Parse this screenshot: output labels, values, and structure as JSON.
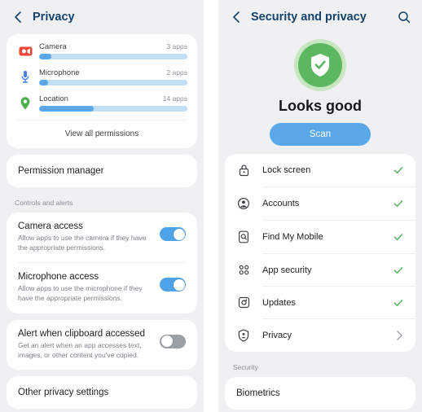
{
  "left": {
    "header": {
      "title": "Privacy",
      "back_icon": "chevron-left-icon"
    },
    "permissions": {
      "items": [
        {
          "icon": "camera-icon",
          "name": "Camera",
          "count": "3 apps",
          "fill_pct": 8
        },
        {
          "icon": "microphone-icon",
          "name": "Microphone",
          "count": "2 apps",
          "fill_pct": 6
        },
        {
          "icon": "location-pin-icon",
          "name": "Location",
          "count": "14 apps",
          "fill_pct": 37
        }
      ],
      "view_all_label": "View all permissions"
    },
    "permission_manager_label": "Permission manager",
    "controls_section_label": "Controls and alerts",
    "toggles": [
      {
        "icon": "toggle-icon",
        "title": "Camera access",
        "description": "Allow apps to use the camera if they have the appropriate permissions.",
        "state": "on"
      },
      {
        "icon": "toggle-icon",
        "title": "Microphone access",
        "description": "Allow apps to use the microphone if they have the appropriate permissions.",
        "state": "on"
      },
      {
        "icon": "toggle-icon",
        "title": "Alert when clipboard accessed",
        "description": "Get an alert when an app accesses text, images, or other content you've copied.",
        "state": "off"
      }
    ],
    "other_settings_label": "Other privacy settings"
  },
  "right": {
    "header": {
      "title": "Security and privacy",
      "back_icon": "chevron-left-icon",
      "search_icon": "search-icon"
    },
    "status": {
      "icon": "shield-check-icon",
      "message": "Looks good",
      "scan_label": "Scan"
    },
    "items": [
      {
        "icon": "lock-icon",
        "label": "Lock screen",
        "trailing": "check"
      },
      {
        "icon": "account-icon",
        "label": "Accounts",
        "trailing": "check"
      },
      {
        "icon": "find-my-mobile-icon",
        "label": "Find My Mobile",
        "trailing": "check"
      },
      {
        "icon": "app-grid-icon",
        "label": "App security",
        "trailing": "check"
      },
      {
        "icon": "updates-icon",
        "label": "Updates",
        "trailing": "check"
      },
      {
        "icon": "shield-person-icon",
        "label": "Privacy",
        "trailing": "chevron"
      }
    ],
    "security_section_label": "Security",
    "biometrics_label": "Biometrics"
  },
  "colors": {
    "background": "#eef0f2",
    "card": "#ffffff",
    "header_text": "#15426b",
    "accent_blue": "#5aa8e8",
    "bar_track": "#c3ddf5",
    "toggle_on": "#4fa3e8",
    "toggle_off": "#9aa0a6",
    "status_green": "#5cb860",
    "status_green_ring": "#c8e6bf",
    "check_green": "#56b45d",
    "camera_red": "#ef4538",
    "mic_blue": "#4a7ce8",
    "location_green": "#4caf50",
    "muted_text": "#8a9097"
  }
}
